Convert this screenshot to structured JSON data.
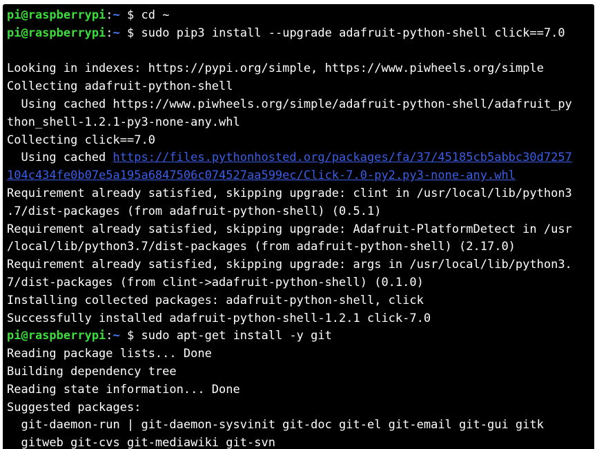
{
  "colors": {
    "background": "#000000",
    "text": "#ffffff",
    "prompt_host": "#3ddc3d",
    "prompt_path": "#4a7bff",
    "link": "#3a5ee8"
  },
  "terminal": {
    "lines": [
      {
        "type": "prompt",
        "user_host": "pi@raspberrypi",
        "sep": ":",
        "path": "~",
        "symbol": " $ ",
        "command": "cd ~"
      },
      {
        "type": "prompt",
        "user_host": "pi@raspberrypi",
        "sep": ":",
        "path": "~",
        "symbol": " $ ",
        "command": "sudo pip3 install --upgrade adafruit-python-shell click==7.0"
      },
      {
        "type": "text",
        "text": ""
      },
      {
        "type": "text",
        "text": "Looking in indexes: https://pypi.org/simple, https://www.piwheels.org/simple"
      },
      {
        "type": "text",
        "text": "Collecting adafruit-python-shell"
      },
      {
        "type": "text",
        "text": "  Using cached https://www.piwheels.org/simple/adafruit-python-shell/adafruit_py"
      },
      {
        "type": "text",
        "text": "thon_shell-1.2.1-py3-none-any.whl"
      },
      {
        "type": "text",
        "text": "Collecting click==7.0"
      },
      {
        "type": "linkline",
        "prefix": "  Using cached ",
        "link": "https://files.pythonhosted.org/packages/fa/37/45185cb5abbc30d7257"
      },
      {
        "type": "linkline",
        "prefix": "",
        "link": "104c434fe0b07e5a195a6847506c074527aa599ec/Click-7.0-py2.py3-none-any.whl"
      },
      {
        "type": "text",
        "text": "Requirement already satisfied, skipping upgrade: clint in /usr/local/lib/python3"
      },
      {
        "type": "text",
        "text": ".7/dist-packages (from adafruit-python-shell) (0.5.1)"
      },
      {
        "type": "text",
        "text": "Requirement already satisfied, skipping upgrade: Adafruit-PlatformDetect in /usr"
      },
      {
        "type": "text",
        "text": "/local/lib/python3.7/dist-packages (from adafruit-python-shell) (2.17.0)"
      },
      {
        "type": "text",
        "text": "Requirement already satisfied, skipping upgrade: args in /usr/local/lib/python3."
      },
      {
        "type": "text",
        "text": "7/dist-packages (from clint->adafruit-python-shell) (0.1.0)"
      },
      {
        "type": "text",
        "text": "Installing collected packages: adafruit-python-shell, click"
      },
      {
        "type": "text",
        "text": "Successfully installed adafruit-python-shell-1.2.1 click-7.0"
      },
      {
        "type": "prompt",
        "user_host": "pi@raspberrypi",
        "sep": ":",
        "path": "~",
        "symbol": " $ ",
        "command": "sudo apt-get install -y git"
      },
      {
        "type": "text",
        "text": "Reading package lists... Done"
      },
      {
        "type": "text",
        "text": "Building dependency tree"
      },
      {
        "type": "text",
        "text": "Reading state information... Done"
      },
      {
        "type": "text",
        "text": "Suggested packages:"
      },
      {
        "type": "text",
        "text": "  git-daemon-run | git-daemon-sysvinit git-doc git-el git-email git-gui gitk"
      },
      {
        "type": "text",
        "text": "  gitweb git-cvs git-mediawiki git-svn"
      }
    ]
  }
}
